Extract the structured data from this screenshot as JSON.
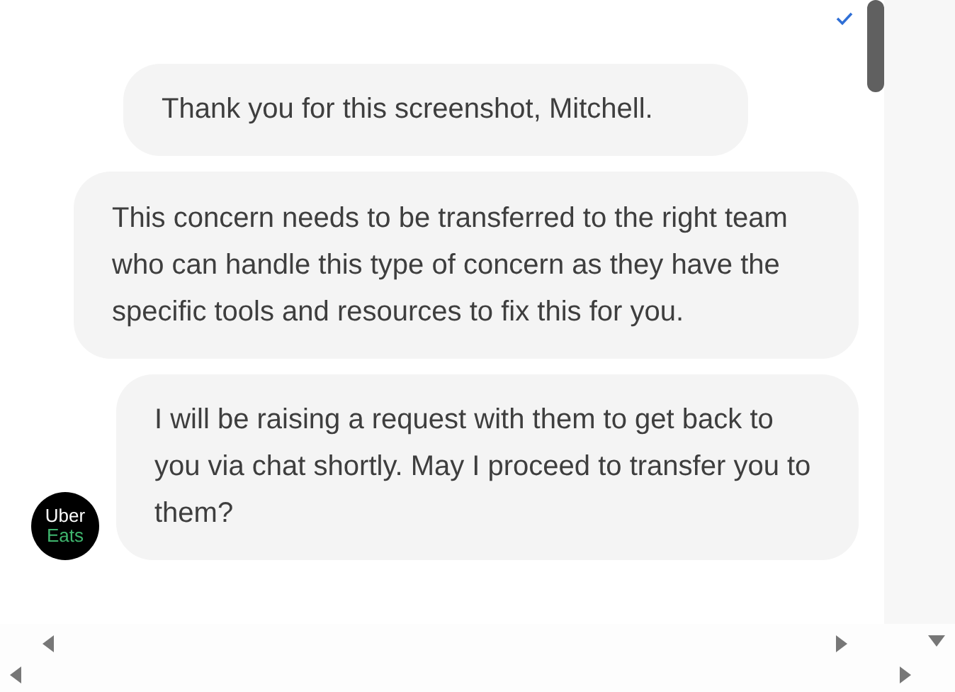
{
  "messages": [
    {
      "text": "Thank you for this screenshot, Mitchell.",
      "avatar": false
    },
    {
      "text": "This concern needs to be transferred to the right team who can handle this type of concern as they have the specific tools and resources to fix this for you.",
      "avatar": false
    },
    {
      "text": "I will be raising a request with them to get back to you via chat shortly. May I proceed to transfer you to them?",
      "avatar": true
    }
  ],
  "read_receipt": true,
  "avatar": {
    "line_1": "Uber",
    "line_2": "Eats"
  }
}
